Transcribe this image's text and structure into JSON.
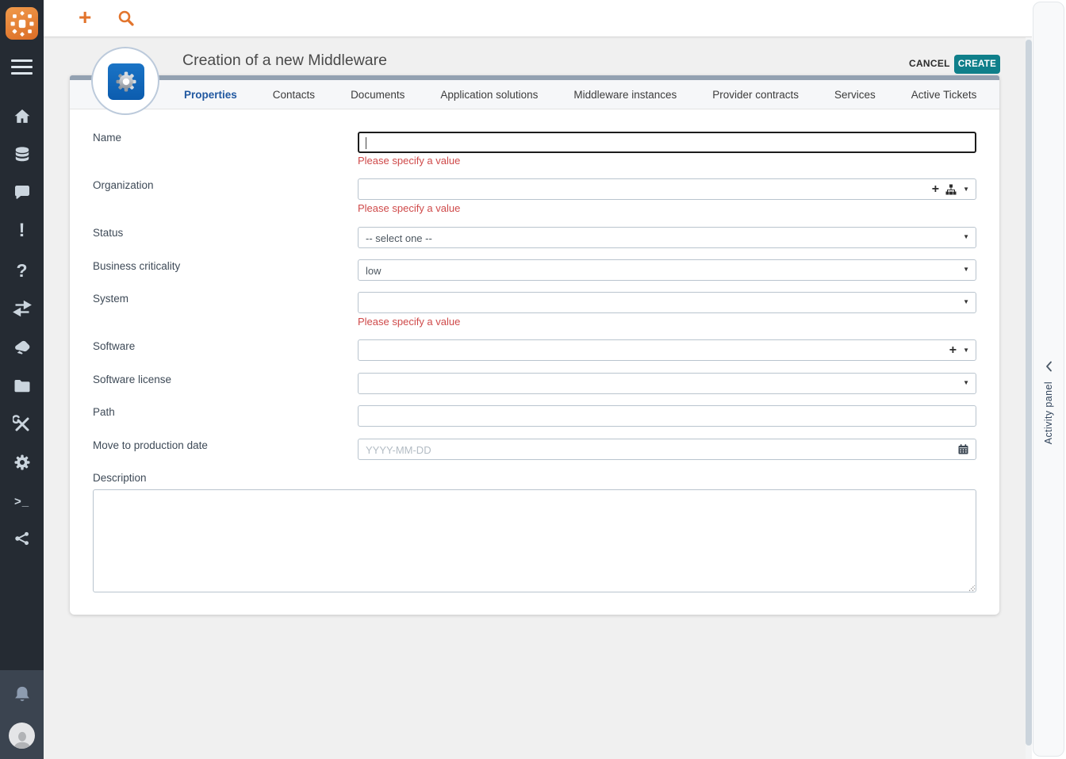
{
  "topbar": {
    "new_object_icon": "plus-icon",
    "search_icon": "search-icon"
  },
  "sidebar": {
    "logo_icon": "itop-logo",
    "menu_icon": "hamburger-icon",
    "items": [
      {
        "icon": "home-icon"
      },
      {
        "icon": "database-icon"
      },
      {
        "icon": "chat-icon"
      },
      {
        "icon": "exclamation-icon"
      },
      {
        "icon": "question-icon"
      },
      {
        "icon": "transfer-arrows-icon"
      },
      {
        "icon": "hand-icon"
      },
      {
        "icon": "folder-icon"
      },
      {
        "icon": "tools-icon"
      },
      {
        "icon": "gear-icon"
      },
      {
        "icon": "terminal-icon"
      },
      {
        "icon": "share-icon"
      }
    ],
    "bottom": {
      "bell_icon": "bell-icon",
      "avatar_icon": "user-avatar"
    }
  },
  "header": {
    "title": "Creation of a new Middleware",
    "cancel": "CANCEL",
    "create": "CREATE",
    "object_icon": "middleware-gear-icon"
  },
  "tabs": [
    {
      "label": "Properties",
      "active": true
    },
    {
      "label": "Contacts",
      "active": false
    },
    {
      "label": "Documents",
      "active": false
    },
    {
      "label": "Application solutions",
      "active": false
    },
    {
      "label": "Middleware instances",
      "active": false
    },
    {
      "label": "Provider contracts",
      "active": false
    },
    {
      "label": "Services",
      "active": false
    },
    {
      "label": "Active Tickets",
      "active": false
    }
  ],
  "form": {
    "fields": [
      {
        "label": "Name",
        "type": "text",
        "value": "",
        "error": "Please specify a value"
      },
      {
        "label": "Organization",
        "type": "picker-hierarchy",
        "value": "",
        "error": "Please specify a value",
        "icons": [
          "plus-icon",
          "sitemap-icon",
          "caret-down-icon"
        ]
      },
      {
        "label": "Status",
        "type": "select",
        "value": "-- select one --"
      },
      {
        "label": "Business criticality",
        "type": "select",
        "value": "low"
      },
      {
        "label": "System",
        "type": "select",
        "value": "",
        "error": "Please specify a value"
      },
      {
        "label": "Software",
        "type": "picker",
        "value": "",
        "icons": [
          "plus-icon",
          "caret-down-icon"
        ]
      },
      {
        "label": "Software license",
        "type": "select",
        "value": ""
      },
      {
        "label": "Path",
        "type": "text",
        "value": ""
      },
      {
        "label": "Move to production date",
        "type": "date",
        "value": "",
        "placeholder": "YYYY-MM-DD",
        "icons": [
          "calendar-icon"
        ]
      },
      {
        "label": "Description",
        "type": "textarea",
        "value": ""
      }
    ]
  },
  "activity_panel": {
    "label": "Activity panel",
    "collapse_icon": "chevron-left-icon"
  },
  "colors": {
    "accent_orange": "#e2742c",
    "create_teal": "#0f7f8a",
    "active_tab_blue": "#2158a0",
    "error_red": "#cf4a4a",
    "sidebar_dark": "#252b33",
    "card_top_bar": "#93a1b1",
    "object_icon_blue": "#1266b3"
  }
}
